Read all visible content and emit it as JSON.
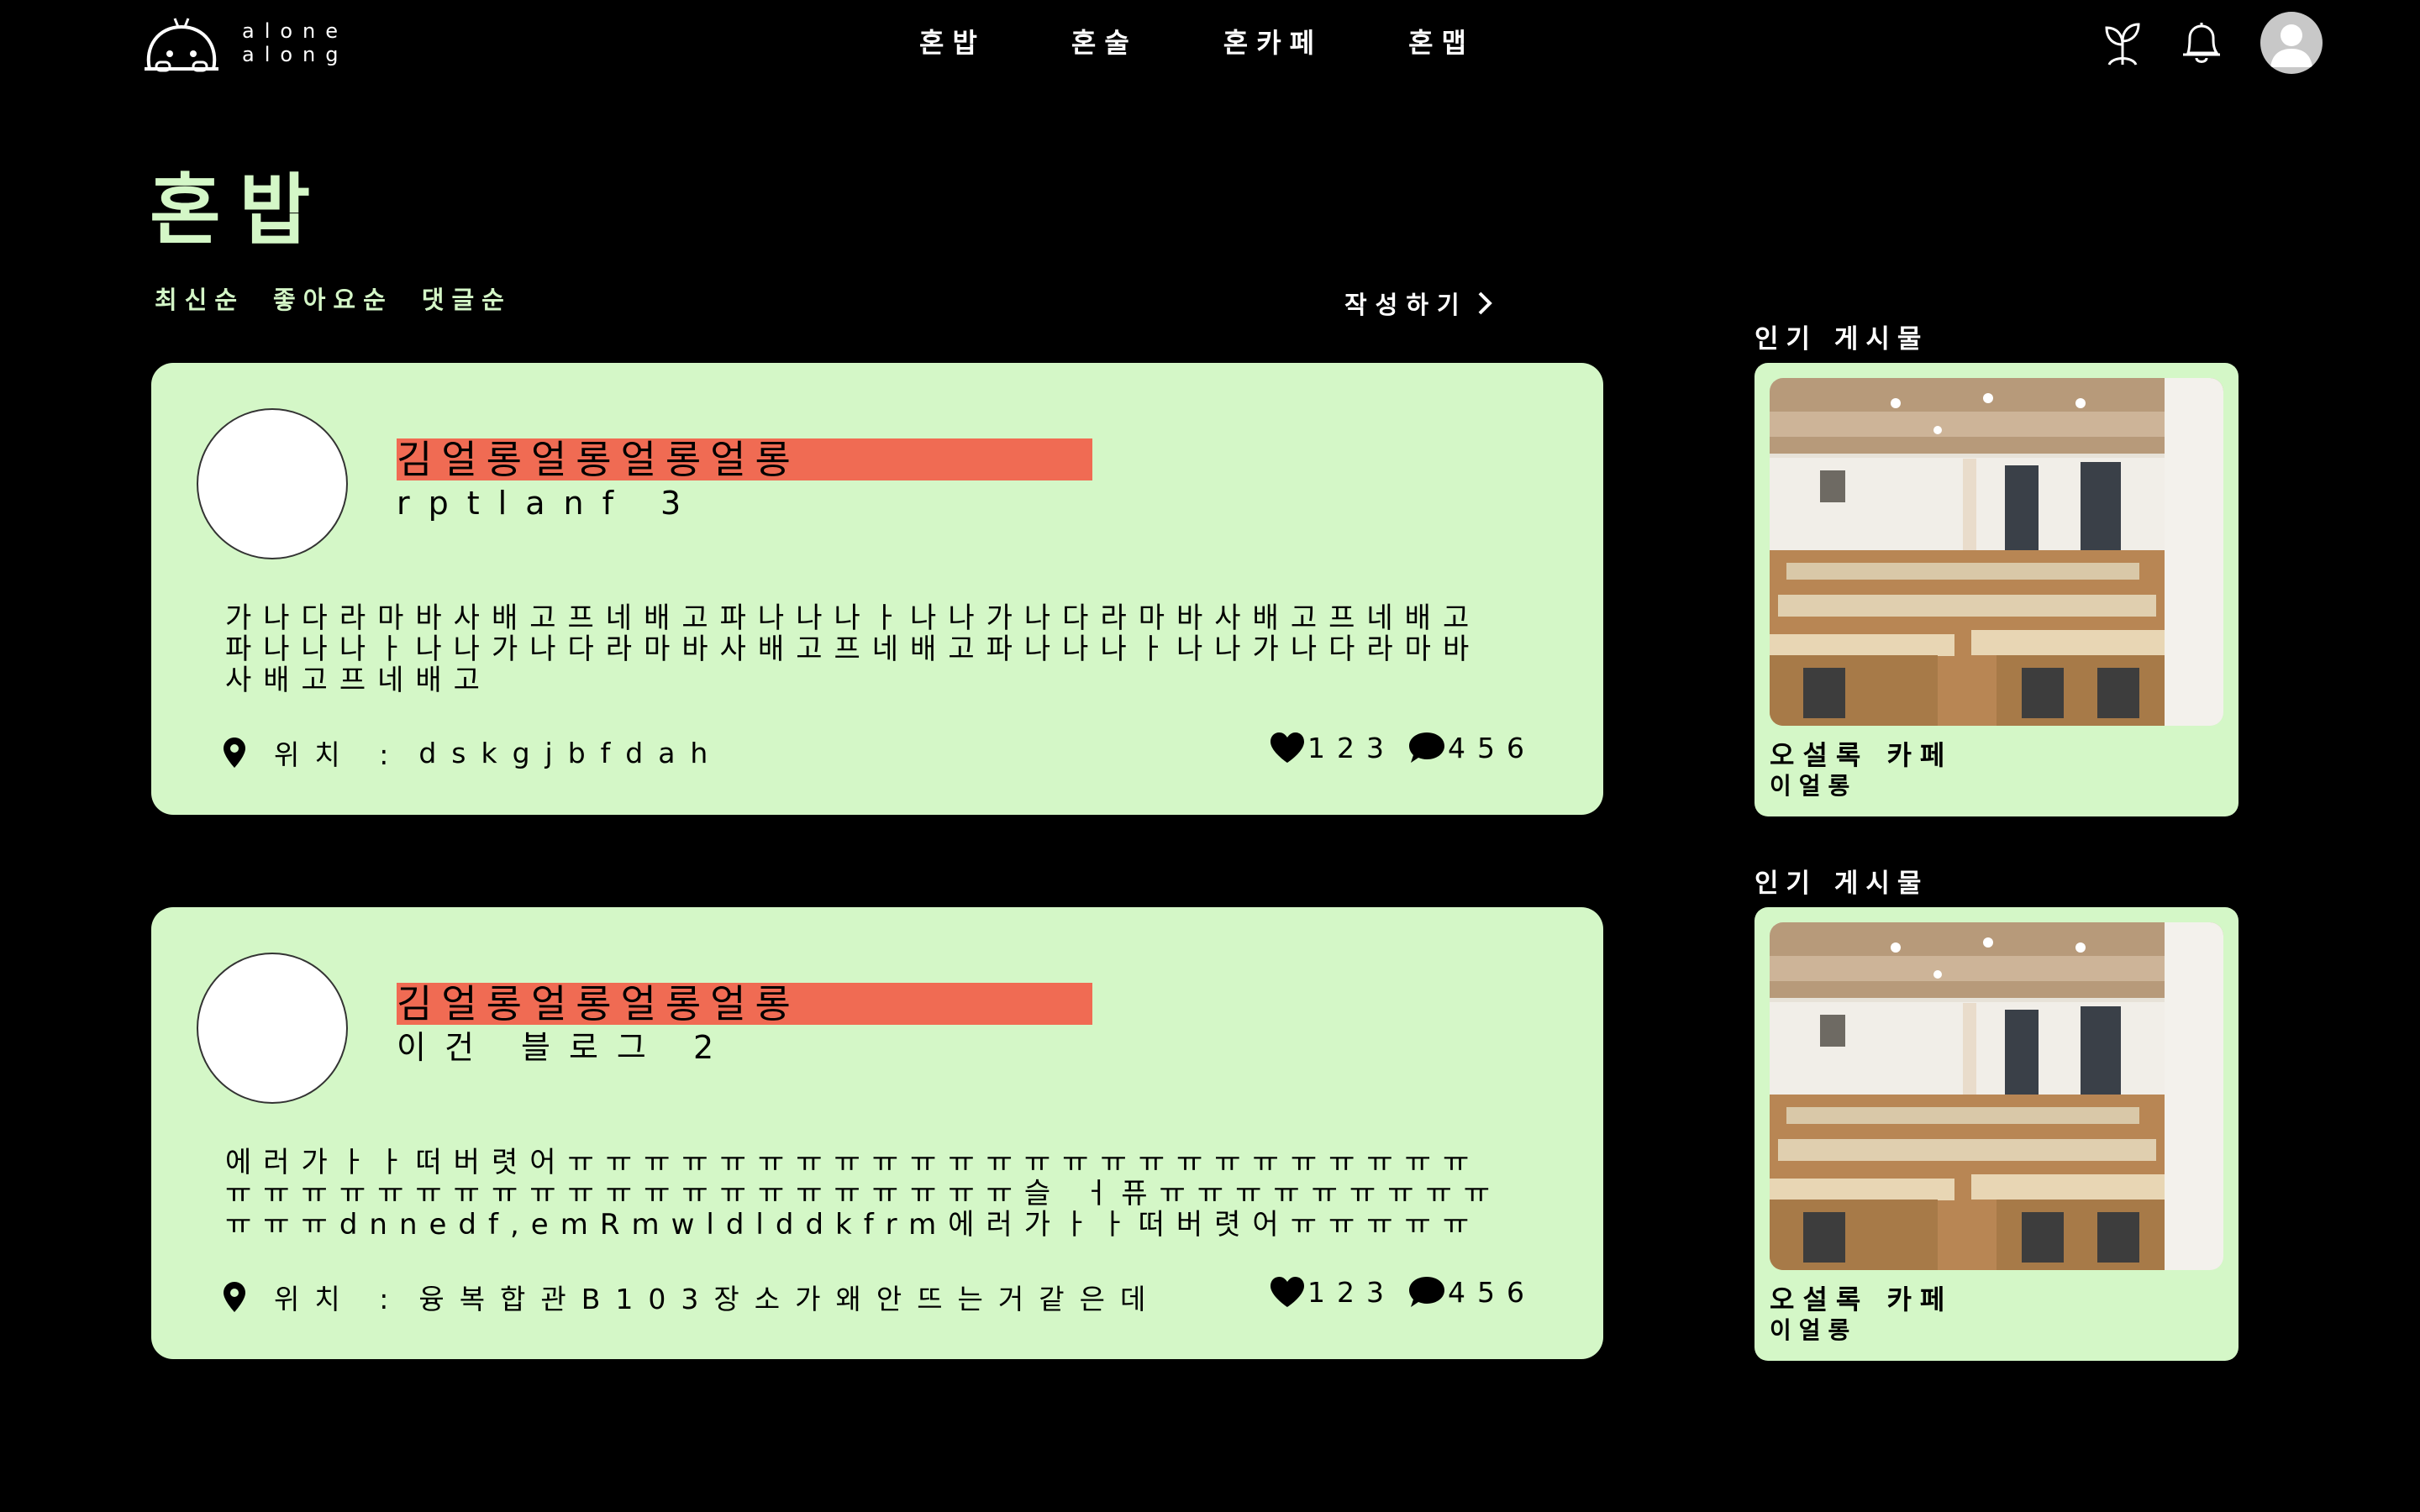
{
  "header": {
    "logo_line1": "alone",
    "logo_line2": "along",
    "nav": [
      "혼밥",
      "혼술",
      "혼카페",
      "혼맵"
    ],
    "icons": [
      "sprout-icon",
      "bell-icon",
      "avatar-icon"
    ]
  },
  "page": {
    "title": "혼밥",
    "sort": [
      "최신순",
      "좋아요순",
      "댓글순"
    ],
    "write_label": "작성하기"
  },
  "posts": [
    {
      "author": "김얼롱얼롱얼롱얼롱",
      "title": "rptlanf 3",
      "body": "가나다라마바사배고프네배고파나나나ㅏ나나가나다라마바사배고프네배고파나나나ㅏ나나가나다라마바사배고프네배고파나나나ㅏ나나가나다라마바사배고프네배고",
      "location_label": "위치 :",
      "location": "dskgjbfdah",
      "likes": "123",
      "comments": "456"
    },
    {
      "author": "김얼롱얼롱얼롱얼롱",
      "title": "이건 블로그 2",
      "body": "에러가ㅏㅏ떠버렷어ㅠㅠㅠㅠㅠㅠㅠㅠㅠㅠㅠㅠㅠㅠㅠㅠㅠㅠㅠㅠㅠㅠㅠㅠㅠㅠㅠㅠㅠㅠㅠㅠㅠㅠㅠㅠㅠㅠㅠㅠㅠㅠㅠㅠㅠ슬 ㅓ퓨ㅠㅠㅠㅠㅠㅠㅠㅠㅠㅠㅠㅠdnnedf,emRmwldlddkfrm에러가ㅏㅏ떠버렷어ㅠㅠㅠㅠㅠㅠㅠ",
      "location_label": "위치 :",
      "location": "융복합관B103장소가왜안뜨는거같은데",
      "likes": "123",
      "comments": "456"
    }
  ],
  "popular": [
    {
      "label": "인기 게시물",
      "name": "오설록 카페",
      "sub": "이얼롱"
    },
    {
      "label": "인기 게시물",
      "name": "오설록 카페",
      "sub": "이얼롱"
    }
  ],
  "colors": {
    "background": "#000000",
    "card": "#d4f7c7",
    "accent_title": "#d4f7c7",
    "author_highlight": "#f06b53"
  }
}
